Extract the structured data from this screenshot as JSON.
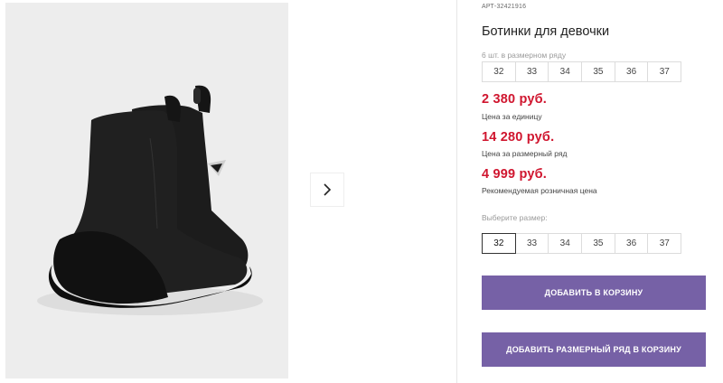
{
  "product": {
    "article_prefix": "АРТ-",
    "article_number": "32421916",
    "title": "Ботинки для девочки",
    "series_label": "6 шт. в размерном ряду",
    "series_sizes": [
      "32",
      "33",
      "34",
      "35",
      "36",
      "37"
    ],
    "prices": [
      {
        "value": "2 380 руб.",
        "note": "Цена за единицу"
      },
      {
        "value": "14 280 руб.",
        "note": "Цена за размерный ряд"
      },
      {
        "value": "4 999 руб.",
        "note": "Рекомендуемая розничная цена"
      }
    ],
    "choose_label": "Выберите размер:",
    "size_options": [
      "32",
      "33",
      "34",
      "35",
      "36",
      "37"
    ],
    "selected_size": "32"
  },
  "actions": {
    "add_to_cart": "ДОБАВИТЬ В КОРЗИНУ",
    "add_series_to_cart": "ДОБАВИТЬ РАЗМЕРНЫЙ РЯД В КОРЗИНУ"
  },
  "colors": {
    "price": "#d0162f",
    "button": "#7661a6",
    "photo_bg": "#ededed"
  },
  "icons": {
    "next": "chevron-right-icon"
  }
}
